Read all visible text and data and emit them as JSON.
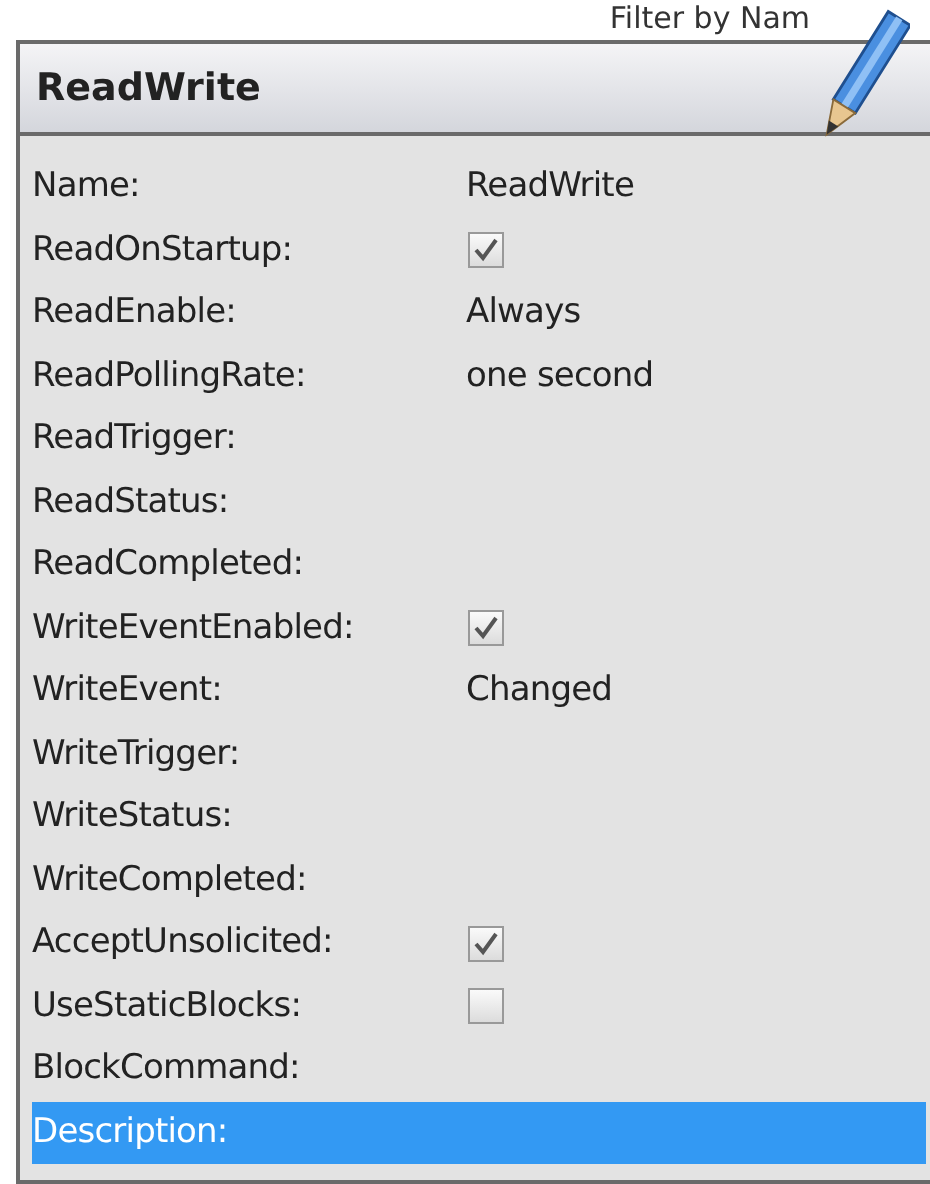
{
  "filter_label": "Filter by Nam",
  "panel": {
    "title": "ReadWrite",
    "rows": [
      {
        "label": "Name:",
        "kind": "text",
        "value": "ReadWrite",
        "selected": false
      },
      {
        "label": "ReadOnStartup:",
        "kind": "checkbox",
        "checked": true,
        "selected": false
      },
      {
        "label": "ReadEnable:",
        "kind": "text",
        "value": "Always",
        "selected": false
      },
      {
        "label": "ReadPollingRate:",
        "kind": "text",
        "value": "one second",
        "selected": false
      },
      {
        "label": "ReadTrigger:",
        "kind": "empty",
        "selected": false
      },
      {
        "label": "ReadStatus:",
        "kind": "empty",
        "selected": false
      },
      {
        "label": "ReadCompleted:",
        "kind": "empty",
        "selected": false
      },
      {
        "label": "WriteEventEnabled:",
        "kind": "checkbox",
        "checked": true,
        "selected": false
      },
      {
        "label": "WriteEvent:",
        "kind": "text",
        "value": "Changed",
        "selected": false
      },
      {
        "label": "WriteTrigger:",
        "kind": "empty",
        "selected": false
      },
      {
        "label": "WriteStatus:",
        "kind": "empty",
        "selected": false
      },
      {
        "label": "WriteCompleted:",
        "kind": "empty",
        "selected": false
      },
      {
        "label": "AcceptUnsolicited:",
        "kind": "checkbox",
        "checked": true,
        "selected": false
      },
      {
        "label": "UseStaticBlocks:",
        "kind": "checkbox",
        "checked": false,
        "selected": false
      },
      {
        "label": "BlockCommand:",
        "kind": "empty",
        "selected": false
      },
      {
        "label": "Description:",
        "kind": "empty",
        "selected": true
      }
    ]
  }
}
